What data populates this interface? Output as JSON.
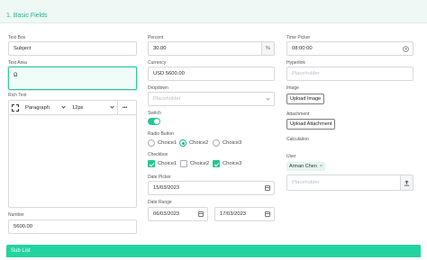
{
  "section": {
    "title": "1. Basic Fields"
  },
  "text_box": {
    "label": "Text Box",
    "value": "Subject"
  },
  "text_area": {
    "label": "Text Area",
    "value": "Ω"
  },
  "rich_text": {
    "label": "Rich Text",
    "paragraph": "Paragraph",
    "size": "12px",
    "more": "•••"
  },
  "number": {
    "label": "Number",
    "value": "5600.00"
  },
  "percent": {
    "label": "Percent",
    "value": "30.00",
    "suffix": "%"
  },
  "currency": {
    "label": "Currency",
    "value": "USD 5600.00"
  },
  "dropdown": {
    "label": "Dropdown",
    "placeholder": "Placeholder"
  },
  "switch": {
    "label": "Switch",
    "on": true
  },
  "radio": {
    "label": "Radio Button",
    "options": [
      "Choice1",
      "Choice2",
      "Choice3"
    ],
    "selected": "Choice2"
  },
  "checkbox": {
    "label": "Checkbox",
    "options": [
      "Choice1",
      "Choice2",
      "Choice3"
    ],
    "checked": [
      "Choice1",
      "Choice3"
    ]
  },
  "date_picker": {
    "label": "Date Picker",
    "value": "15/03/2023"
  },
  "date_range": {
    "label": "Date Range",
    "start": "06/03/2023",
    "end": "17/03/2023"
  },
  "time_picker": {
    "label": "Time Picker",
    "value": "08:00:00"
  },
  "hyperlink": {
    "label": "Hyperlink",
    "placeholder": "Placeholder"
  },
  "image": {
    "label": "Image",
    "button": "Upload Image"
  },
  "attachment": {
    "label": "Attachment",
    "button": "Upload Attachment"
  },
  "calculation": {
    "label": "Calculation"
  },
  "user": {
    "label": "User",
    "tag": "Arman Chen",
    "tag_close": "×",
    "placeholder": "Placeholder"
  },
  "sub_list": {
    "title": "Sub List"
  },
  "colors": {
    "accent": "#20b58f",
    "accent_bright": "#23d39e",
    "header_bg": "#eef8f4"
  }
}
